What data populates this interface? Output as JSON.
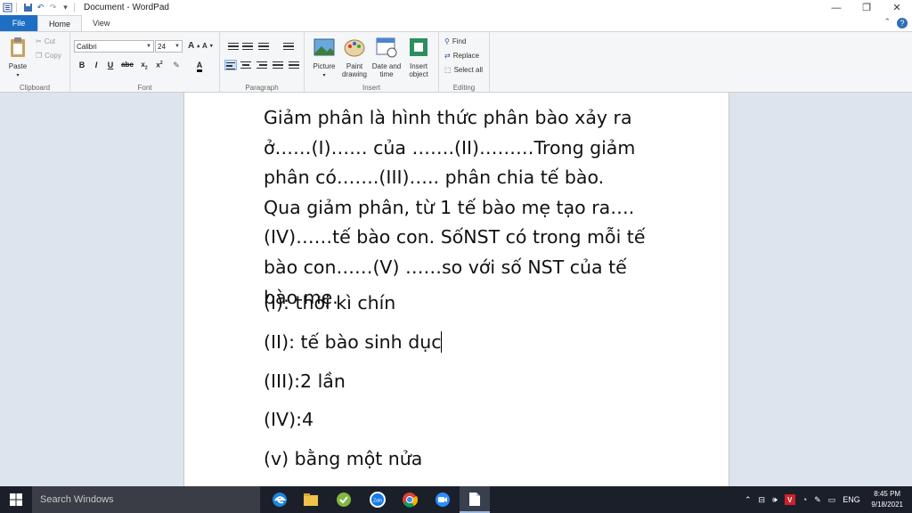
{
  "window": {
    "title": "Document - WordPad",
    "tabs": [
      "File",
      "Home",
      "View"
    ]
  },
  "ribbon": {
    "clipboard": {
      "label": "Clipboard",
      "paste": "Paste",
      "cut": "Cut",
      "copy": "Copy"
    },
    "font": {
      "label": "Font",
      "family": "Calibri",
      "size": "24"
    },
    "paragraph": {
      "label": "Paragraph"
    },
    "insert": {
      "label": "Insert",
      "picture": "Picture",
      "paint_line1": "Paint",
      "paint_line2": "drawing",
      "datetime_line1": "Date and",
      "datetime_line2": "time",
      "object_line1": "Insert",
      "object_line2": "object"
    },
    "editing": {
      "label": "Editing",
      "find": "Find",
      "replace": "Replace",
      "select_all": "Select all"
    }
  },
  "document": {
    "paragraph": "Giảm phân là hình thức phân bào xảy ra ở……(I)…… của …….(II)………Trong giảm phân có…….(III)….. phân chia tế bào. Qua giảm phân, từ 1 tế bào mẹ tạo ra….(IV)……tế bào con. SốNST có trong mỗi tế bào con……(V) ……so với số NST của tế bào mẹ.",
    "answers": [
      "(I): thời kì chín",
      "(II): tế bào sinh dục",
      "(III):2 lần",
      "(IV):4",
      "(v) bằng một nửa"
    ]
  },
  "taskbar": {
    "search_placeholder": "Search Windows",
    "language": "ENG",
    "time": "8:45 PM",
    "date": "9/18/2021"
  },
  "colors": {
    "file_tab": "#1e6fc4",
    "taskbar": "#1b1f2a",
    "search": "#3a3d46"
  }
}
